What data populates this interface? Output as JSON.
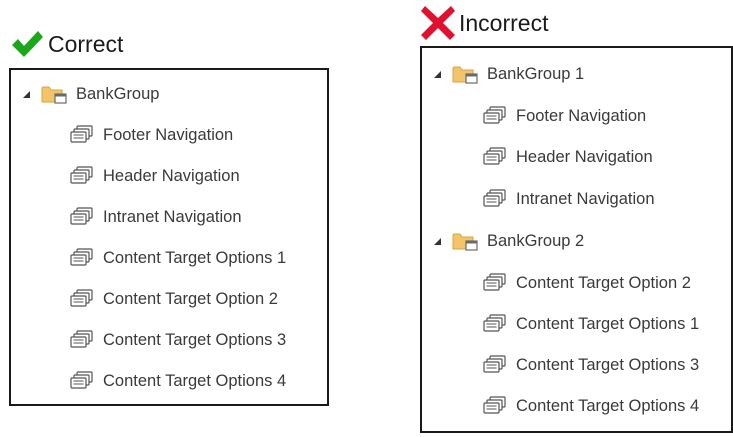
{
  "correct": {
    "heading": "Correct",
    "mark_color": "#1aa81a",
    "tree": {
      "group": {
        "label": "BankGroup",
        "icon": "folder-group-icon",
        "expanded": true
      },
      "children": [
        {
          "label": "Footer Navigation",
          "icon": "navigation-set-icon"
        },
        {
          "label": "Header Navigation",
          "icon": "navigation-set-icon"
        },
        {
          "label": "Intranet Navigation",
          "icon": "navigation-set-icon"
        },
        {
          "label": "Content Target Options 1",
          "icon": "navigation-set-icon"
        },
        {
          "label": "Content Target Option 2",
          "icon": "navigation-set-icon"
        },
        {
          "label": "Content Target Options 3",
          "icon": "navigation-set-icon"
        },
        {
          "label": "Content Target Options 4",
          "icon": "navigation-set-icon"
        }
      ]
    }
  },
  "incorrect": {
    "heading": "Incorrect",
    "mark_color": "#e0102f",
    "tree": [
      {
        "group": {
          "label": "BankGroup 1",
          "icon": "folder-group-icon",
          "expanded": true
        },
        "children": [
          {
            "label": "Footer Navigation",
            "icon": "navigation-set-icon"
          },
          {
            "label": "Header Navigation",
            "icon": "navigation-set-icon"
          },
          {
            "label": "Intranet Navigation",
            "icon": "navigation-set-icon"
          }
        ]
      },
      {
        "group": {
          "label": "BankGroup 2",
          "icon": "folder-group-icon",
          "expanded": true
        },
        "children": [
          {
            "label": "Content Target Option 2",
            "icon": "navigation-set-icon"
          },
          {
            "label": "Content Target Options 1",
            "icon": "navigation-set-icon"
          },
          {
            "label": "Content Target Options 3",
            "icon": "navigation-set-icon"
          },
          {
            "label": "Content Target Options 4",
            "icon": "navigation-set-icon"
          }
        ]
      }
    ]
  }
}
